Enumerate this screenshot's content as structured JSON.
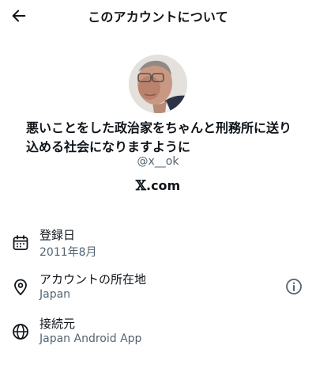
{
  "header": {
    "title": "このアカウントについて"
  },
  "profile": {
    "bio": "悪いことをした政治家をちゃんと刑務所に送り込める社会になりますように",
    "handle": "@x__ok",
    "domain_mark": "𝕏",
    "domain_suffix": ".com"
  },
  "details": [
    {
      "icon": "calendar-icon",
      "label": "登録日",
      "value": "2011年8月"
    },
    {
      "icon": "location-pin-icon",
      "label": "アカウントの所在地",
      "value": "Japan"
    },
    {
      "icon": "globe-icon",
      "label": "接続元",
      "value": "Japan Android App"
    }
  ],
  "icons": {
    "back": "back-arrow-icon",
    "info": "info-icon"
  }
}
